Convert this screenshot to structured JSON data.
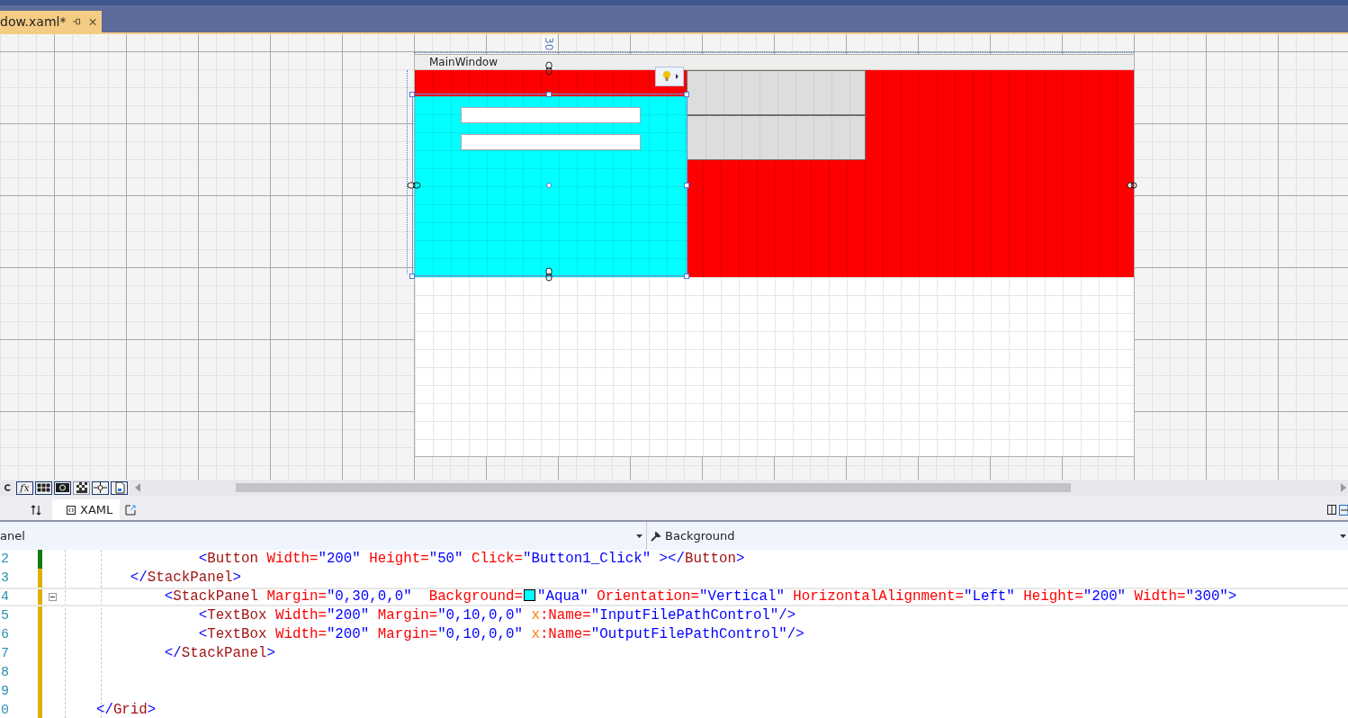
{
  "document_tab": {
    "title": "dow.xaml*",
    "modified": true
  },
  "designer": {
    "ruler_label": "30",
    "window_title": "MainWindow"
  },
  "designer_toolbar": {
    "formula_label": "fx"
  },
  "view_tabs": [
    {
      "label": "XAML",
      "selected": true
    }
  ],
  "element_dropdown": {
    "value": "anel"
  },
  "property_dropdown": {
    "value": "Background"
  },
  "editor": {
    "lines": [
      {
        "number": "2",
        "saved": true,
        "current": false,
        "foldable": false,
        "tokens": [
          {
            "kind": "punct",
            "t": "                <"
          },
          {
            "kind": "tag",
            "t": "Button"
          },
          {
            "kind": "attr",
            "t": " Width="
          },
          {
            "kind": "value",
            "t": "\"200\""
          },
          {
            "kind": "attr",
            "t": " Height="
          },
          {
            "kind": "value",
            "t": "\"50\""
          },
          {
            "kind": "attr",
            "t": " Click="
          },
          {
            "kind": "value",
            "t": "\"Button1_Click\""
          },
          {
            "kind": "punct",
            "t": " ></"
          },
          {
            "kind": "tag",
            "t": "Button"
          },
          {
            "kind": "punct",
            "t": ">"
          }
        ]
      },
      {
        "number": "3",
        "saved": false,
        "current": false,
        "foldable": false,
        "tokens": [
          {
            "kind": "punct",
            "t": "        </"
          },
          {
            "kind": "tag",
            "t": "StackPanel"
          },
          {
            "kind": "punct",
            "t": ">"
          }
        ]
      },
      {
        "number": "4",
        "saved": false,
        "current": true,
        "foldable": true,
        "tokens": [
          {
            "kind": "punct",
            "t": "            <"
          },
          {
            "kind": "tag",
            "t": "StackPanel"
          },
          {
            "kind": "attr",
            "t": " Margin="
          },
          {
            "kind": "value",
            "t": "\"0,30,0,0\""
          },
          {
            "kind": "attr",
            "t": "  Background="
          },
          {
            "kind": "swatch",
            "color": "#00ffff"
          },
          {
            "kind": "value",
            "t": "\"Aqua\""
          },
          {
            "kind": "attr",
            "t": " Orientation="
          },
          {
            "kind": "value",
            "t": "\"Vertical\""
          },
          {
            "kind": "attr",
            "t": " HorizontalAlignment="
          },
          {
            "kind": "value",
            "t": "\"Left\""
          },
          {
            "kind": "attr",
            "t": " Height="
          },
          {
            "kind": "value",
            "t": "\"200\""
          },
          {
            "kind": "attr",
            "t": " Width="
          },
          {
            "kind": "value",
            "t": "\"300\""
          },
          {
            "kind": "punct",
            "t": ">"
          }
        ]
      },
      {
        "number": "5",
        "saved": false,
        "current": false,
        "foldable": false,
        "tokens": [
          {
            "kind": "punct",
            "t": "                <"
          },
          {
            "kind": "tag",
            "t": "TextBox"
          },
          {
            "kind": "attr",
            "t": " Width="
          },
          {
            "kind": "value",
            "t": "\"200\""
          },
          {
            "kind": "attr",
            "t": " Margin="
          },
          {
            "kind": "value",
            "t": "\"0,10,0,0\""
          },
          {
            "kind": "namespace",
            "t": " x"
          },
          {
            "kind": "attr",
            "t": ":Name="
          },
          {
            "kind": "value",
            "t": "\"InputFilePathControl\""
          },
          {
            "kind": "punct",
            "t": "/>"
          }
        ]
      },
      {
        "number": "6",
        "saved": false,
        "current": false,
        "foldable": false,
        "tokens": [
          {
            "kind": "punct",
            "t": "                <"
          },
          {
            "kind": "tag",
            "t": "TextBox"
          },
          {
            "kind": "attr",
            "t": " Width="
          },
          {
            "kind": "value",
            "t": "\"200\""
          },
          {
            "kind": "attr",
            "t": " Margin="
          },
          {
            "kind": "value",
            "t": "\"0,10,0,0\""
          },
          {
            "kind": "namespace",
            "t": " x"
          },
          {
            "kind": "attr",
            "t": ":Name="
          },
          {
            "kind": "value",
            "t": "\"OutputFilePathControl\""
          },
          {
            "kind": "punct",
            "t": "/>"
          }
        ]
      },
      {
        "number": "7",
        "saved": false,
        "current": false,
        "foldable": false,
        "tokens": [
          {
            "kind": "punct",
            "t": "            </"
          },
          {
            "kind": "tag",
            "t": "StackPanel"
          },
          {
            "kind": "punct",
            "t": ">"
          }
        ]
      },
      {
        "number": "8",
        "saved": false,
        "current": false,
        "foldable": false
      },
      {
        "number": "9",
        "saved": false,
        "current": false,
        "foldable": false
      },
      {
        "number": "0",
        "saved": false,
        "current": false,
        "foldable": false,
        "tokens": [
          {
            "kind": "punct",
            "t": "    </"
          },
          {
            "kind": "tag",
            "t": "Grid"
          },
          {
            "kind": "punct",
            "t": ">"
          }
        ]
      }
    ]
  }
}
